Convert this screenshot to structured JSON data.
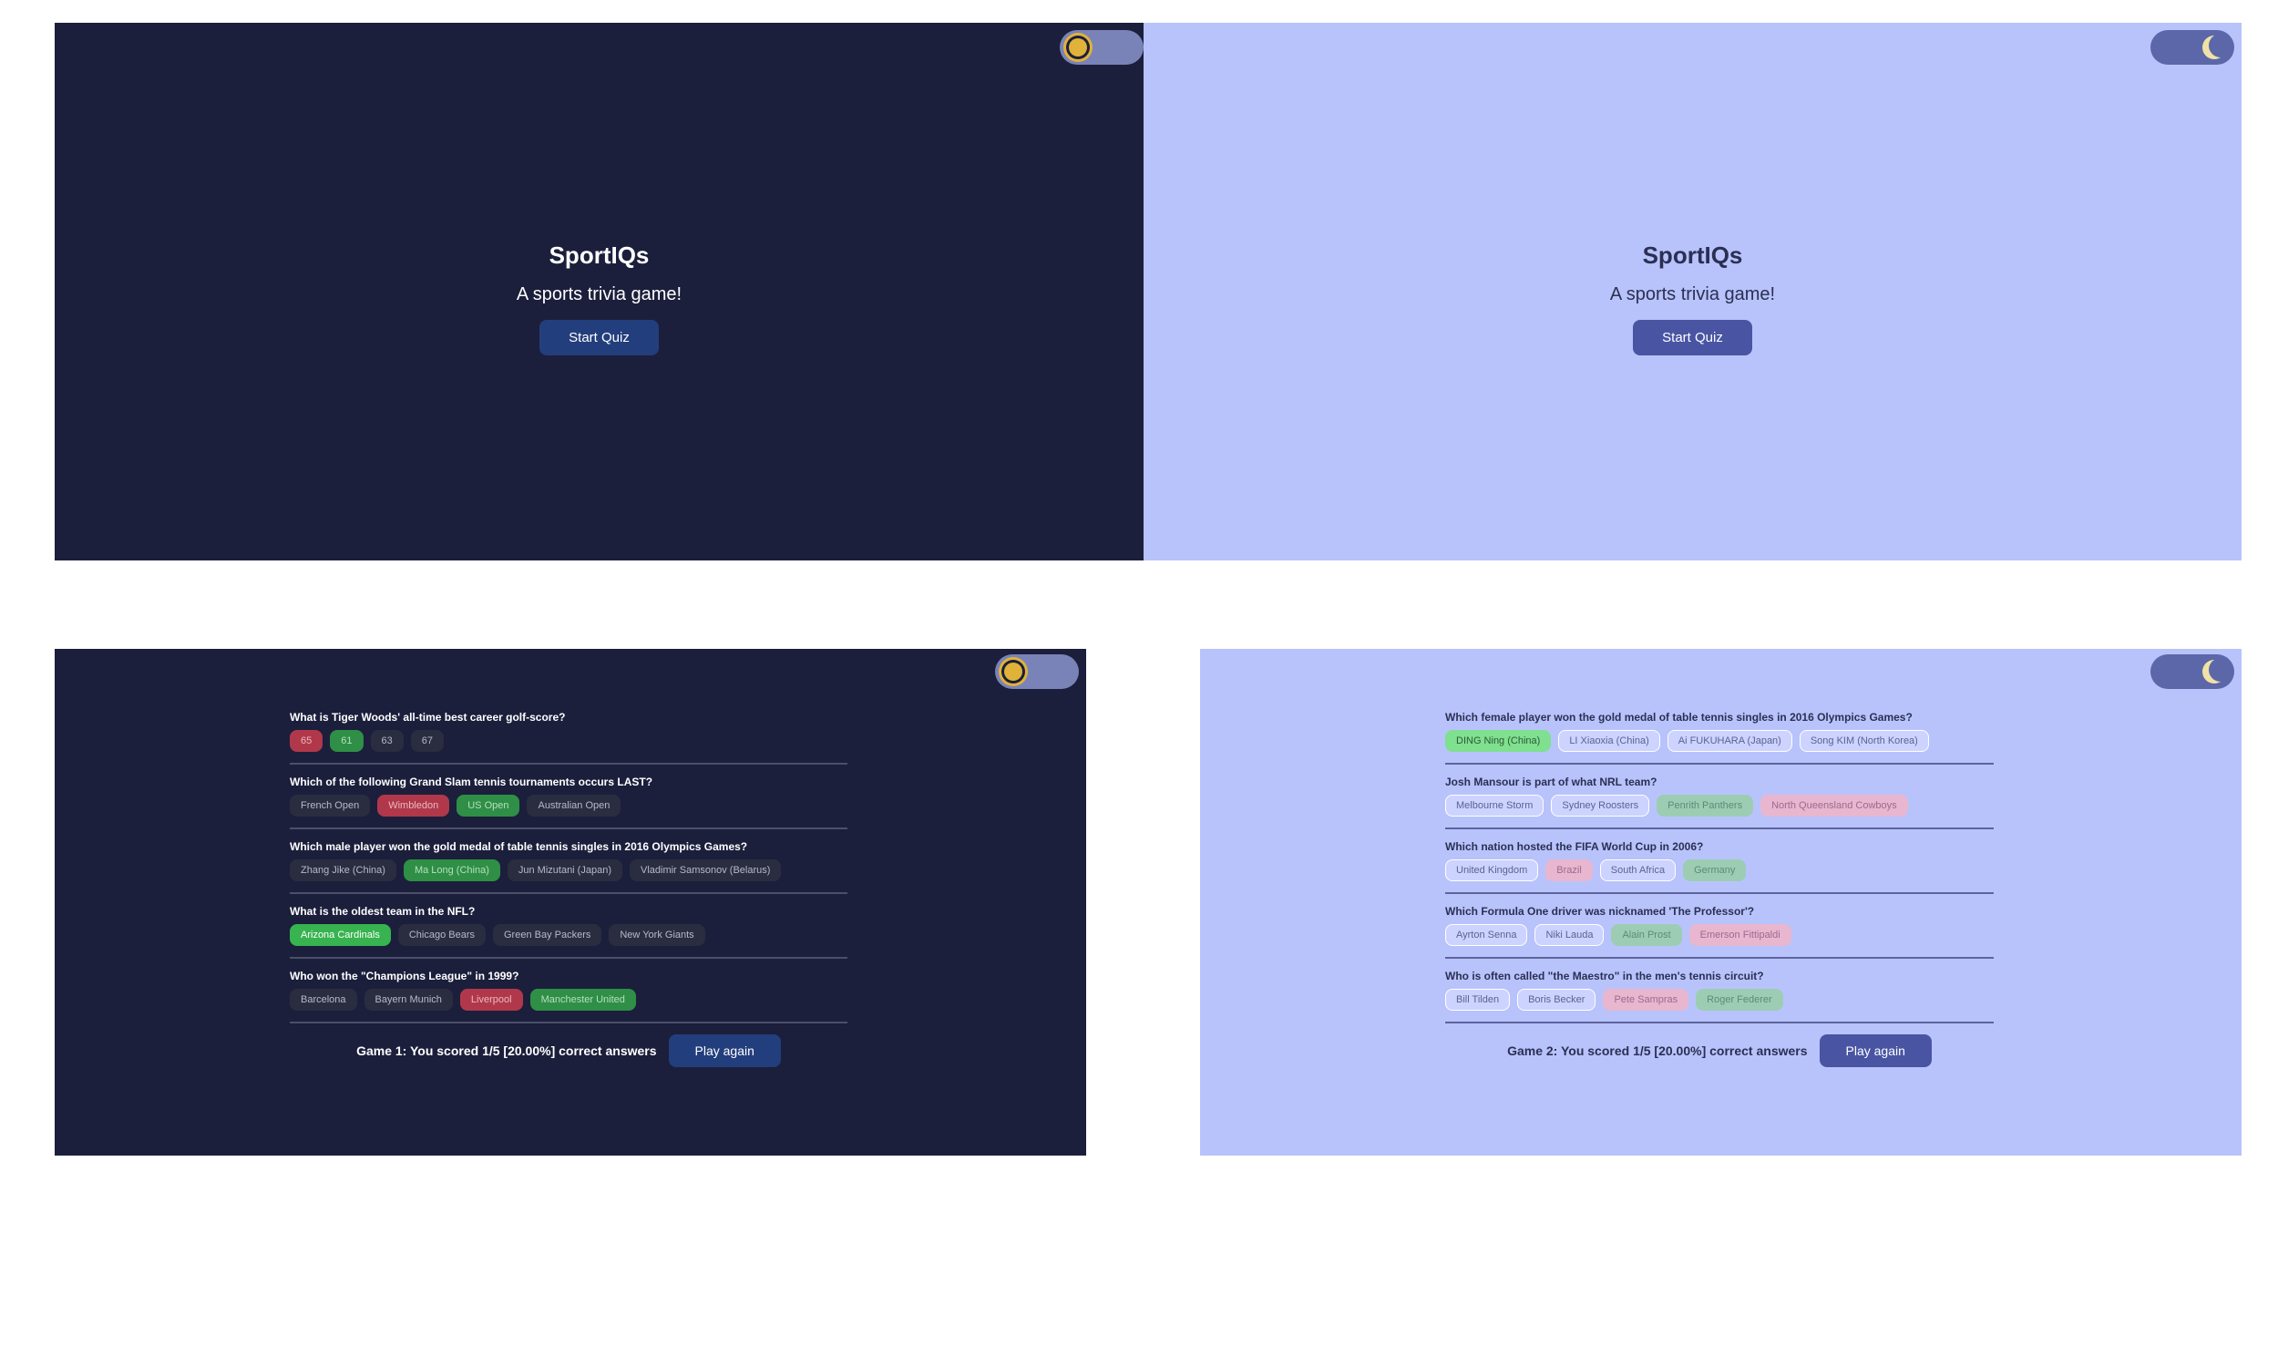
{
  "intro_dark": {
    "title": "SportIQs",
    "subtitle": "A sports trivia game!",
    "start_label": "Start Quiz"
  },
  "intro_light": {
    "title": "SportIQs",
    "subtitle": "A sports trivia game!",
    "start_label": "Start Quiz"
  },
  "game1": {
    "questions": [
      {
        "text": "What is Tiger Woods' all-time best career golf-score?",
        "answers": [
          "65",
          "61",
          "63",
          "67"
        ]
      },
      {
        "text": "Which of the following Grand Slam tennis tournaments occurs LAST?",
        "answers": [
          "French Open",
          "Wimbledon",
          "US Open",
          "Australian Open"
        ]
      },
      {
        "text": "Which male player won the gold medal of table tennis singles in 2016 Olympics Games?",
        "answers": [
          "Zhang Jike (China)",
          "Ma Long (China)",
          "Jun Mizutani (Japan)",
          "Vladimir Samsonov (Belarus)"
        ]
      },
      {
        "text": "What is the oldest team in the NFL?",
        "answers": [
          "Arizona Cardinals",
          "Chicago Bears",
          "Green Bay Packers",
          "New York Giants"
        ]
      },
      {
        "text": "Who won the \"Champions League\" in 1999?",
        "answers": [
          "Barcelona",
          "Bayern Munich",
          "Liverpool",
          "Manchester United"
        ]
      }
    ],
    "score_text": "Game 1: You scored 1/5 [20.00%] correct answers",
    "play_again_label": "Play again"
  },
  "game2": {
    "questions": [
      {
        "text": "Which female player won the gold medal of table tennis singles in 2016 Olympics Games?",
        "answers": [
          "DING Ning (China)",
          "LI Xiaoxia (China)",
          "Ai FUKUHARA (Japan)",
          "Song KIM (North Korea)"
        ]
      },
      {
        "text": "Josh Mansour is part of what NRL team?",
        "answers": [
          "Melbourne Storm",
          "Sydney Roosters",
          "Penrith Panthers",
          "North Queensland Cowboys"
        ]
      },
      {
        "text": "Which nation hosted the FIFA World Cup in 2006?",
        "answers": [
          "United Kingdom",
          "Brazil",
          "South Africa",
          "Germany"
        ]
      },
      {
        "text": "Which Formula One driver was nicknamed 'The Professor'?",
        "answers": [
          "Ayrton Senna",
          "Niki Lauda",
          "Alain Prost",
          "Emerson Fittipaldi"
        ]
      },
      {
        "text": "Who is often called \"the Maestro\" in the men's tennis circuit?",
        "answers": [
          "Bill Tilden",
          "Boris Becker",
          "Pete Sampras",
          "Roger Federer"
        ]
      }
    ],
    "score_text": "Game 2: You scored 1/5 [20.00%] correct answers",
    "play_again_label": "Play again"
  },
  "icons": {
    "light_mode": "sun-icon",
    "dark_mode": "moon-icon"
  },
  "colors": {
    "dark_bg": "#1b1f3b",
    "light_bg": "#b8c3fc",
    "correct": "#37b34f",
    "wrong": "#b1384a"
  }
}
